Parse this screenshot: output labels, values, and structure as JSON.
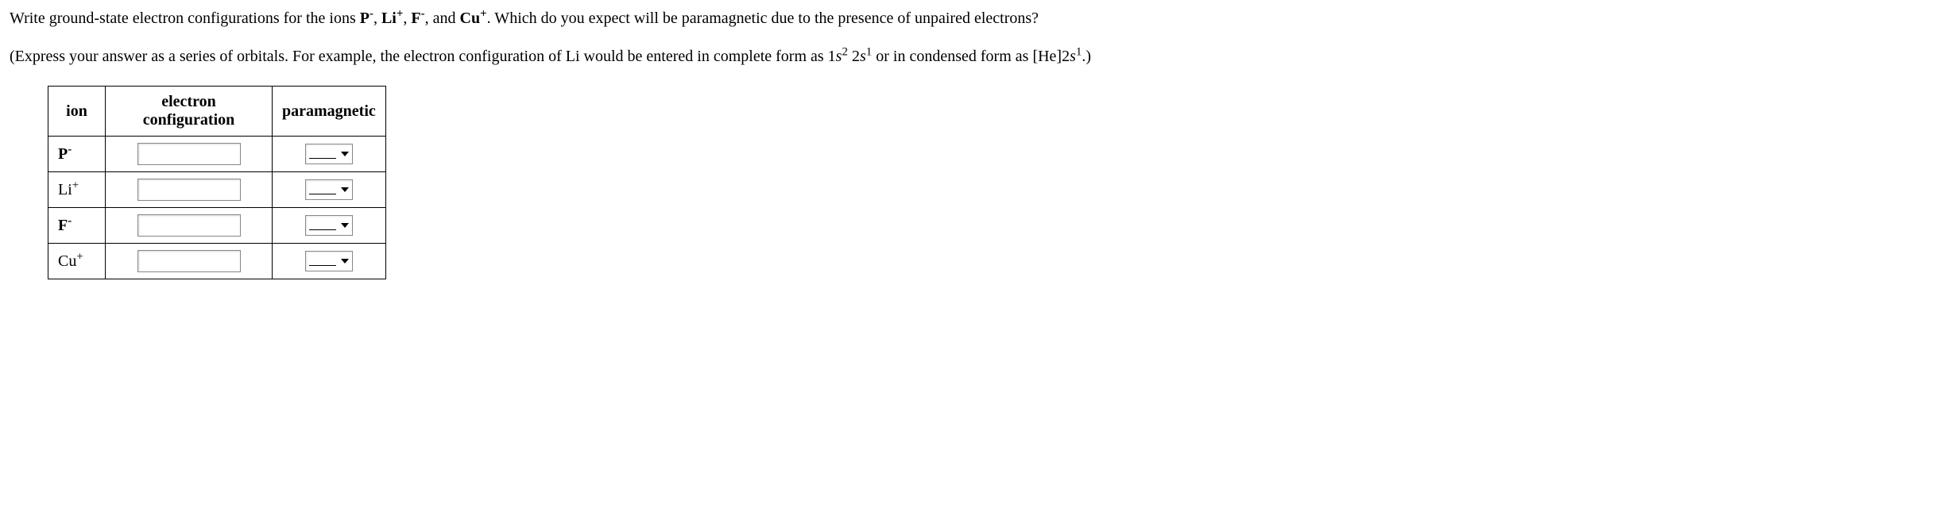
{
  "question": {
    "prefix": "Write ground-state electron configurations for the ions ",
    "ion1_base": "P",
    "ion1_sup": "-",
    "sep1": ", ",
    "ion2_base": "Li",
    "ion2_sup": "+",
    "sep2": ", ",
    "ion3_base": "F",
    "ion3_sup": "-",
    "sep3": ", and ",
    "ion4_base": "Cu",
    "ion4_sup": "+",
    "suffix": ". Which do you expect will be paramagnetic due to the presence of unpaired electrons?"
  },
  "hint": {
    "prefix": "(Express your answer as a series of orbitals. For example, the electron configuration of Li would be entered in complete form as ",
    "ex1_a": "1",
    "ex1_b": "s",
    "ex1_c": "2",
    "ex1_d": " 2",
    "ex1_e": "s",
    "ex1_f": "1",
    "mid": " or in condensed form as ",
    "ex2_a": "[He]2",
    "ex2_b": "s",
    "ex2_c": "1",
    "suffix": ".)"
  },
  "table": {
    "headers": {
      "ion": "ion",
      "config": "electron configuration",
      "para": "paramagnetic"
    },
    "rows": [
      {
        "ion_base": "P",
        "ion_sup": "-",
        "config": "",
        "para": ""
      },
      {
        "ion_base": "Li",
        "ion_sup": "+",
        "config": "",
        "para": ""
      },
      {
        "ion_base": "F",
        "ion_sup": "-",
        "config": "",
        "para": ""
      },
      {
        "ion_base": "Cu",
        "ion_sup": "+",
        "config": "",
        "para": ""
      }
    ]
  }
}
